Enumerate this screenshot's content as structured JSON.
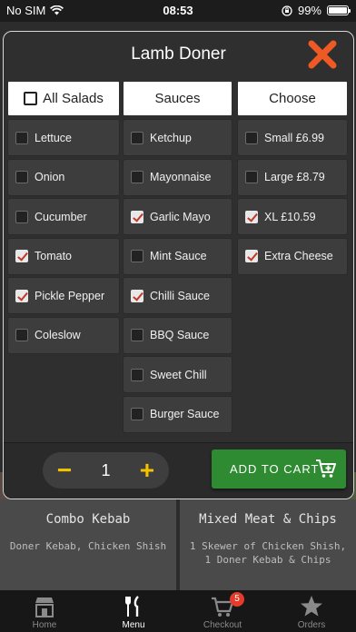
{
  "status_bar": {
    "carrier": "No SIM",
    "time": "08:53",
    "battery": "99%",
    "battery_level": 0.99
  },
  "modal": {
    "title": "Lamb Doner",
    "columns": [
      {
        "header": "All Salads",
        "header_checkbox": true,
        "items": [
          {
            "label": "Lettuce",
            "checked": false
          },
          {
            "label": "Onion",
            "checked": false
          },
          {
            "label": "Cucumber",
            "checked": false
          },
          {
            "label": "Tomato",
            "checked": true
          },
          {
            "label": "Pickle Pepper",
            "checked": true
          },
          {
            "label": "Coleslow",
            "checked": false
          }
        ]
      },
      {
        "header": "Sauces",
        "header_checkbox": false,
        "items": [
          {
            "label": "Ketchup",
            "checked": false
          },
          {
            "label": "Mayonnaise",
            "checked": false
          },
          {
            "label": "Garlic Mayo",
            "checked": true
          },
          {
            "label": "Mint Sauce",
            "checked": false
          },
          {
            "label": "Chilli Sauce",
            "checked": true
          },
          {
            "label": "BBQ Sauce",
            "checked": false
          },
          {
            "label": "Sweet Chill",
            "checked": false
          },
          {
            "label": "Burger Sauce",
            "checked": false
          }
        ]
      },
      {
        "header": "Choose",
        "header_checkbox": false,
        "items": [
          {
            "label": "Small £6.99",
            "checked": false
          },
          {
            "label": "Large £8.79",
            "checked": false
          },
          {
            "label": "XL £10.59",
            "checked": true
          },
          {
            "label": "Extra Cheese",
            "checked": true
          }
        ]
      }
    ],
    "quantity": {
      "minus": "−",
      "value": "1",
      "plus": "+"
    },
    "add_to_cart_label": "ADD TO CART",
    "colors": {
      "accent_yellow": "#f4c300",
      "close_orange": "#ef5a24",
      "add_green": "#2e8b32",
      "check_red": "#c0392b"
    }
  },
  "background_menu": {
    "cards": [
      {
        "title": "Combo Kebab",
        "description": "Doner Kebab, Chicken Shish"
      },
      {
        "title": "Mixed Meat & Chips",
        "description": "1 Skewer of Chicken Shish, 1 Doner Kebab & Chips"
      }
    ]
  },
  "tab_bar": {
    "tabs": [
      {
        "label": "Home",
        "icon": "store-icon"
      },
      {
        "label": "Menu",
        "icon": "fork-knife-icon",
        "active": true
      },
      {
        "label": "Checkout",
        "icon": "cart-icon",
        "badge": "5"
      },
      {
        "label": "Orders",
        "icon": "star-icon"
      }
    ]
  }
}
